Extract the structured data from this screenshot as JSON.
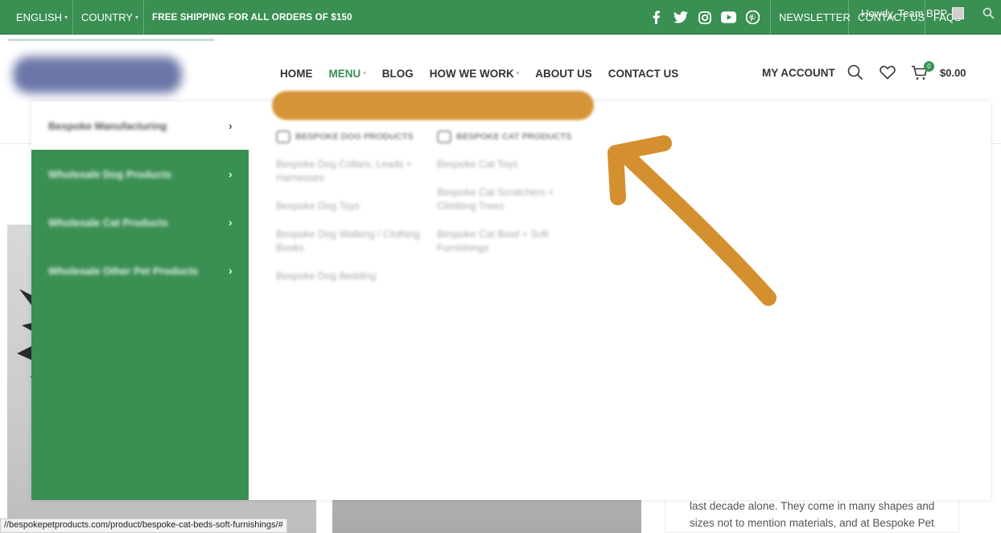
{
  "topbar": {
    "language": "ENGLISH",
    "country": "COUNTRY",
    "shipping": "FREE SHIPPING FOR ALL ORDERS OF $150",
    "newsletter": "NEWSLETTER",
    "contact": "CONTACT US",
    "faqs": "FAQS",
    "howdy": "Howdy, Team BPP",
    "social": [
      "facebook-icon",
      "twitter-icon",
      "instagram-icon",
      "youtube-icon",
      "pinterest-icon"
    ]
  },
  "header": {
    "nav": [
      "HOME",
      "MENU",
      "BLOG",
      "HOW WE WORK",
      "ABOUT US",
      "CONTACT US"
    ],
    "account": "MY ACCOUNT",
    "cart_count": "0",
    "cart_total": "$0.00"
  },
  "menu": {
    "categories": [
      "Bespoke Manufacturing",
      "Wholesale Dog Products",
      "Wholesale Cat Products",
      "Wholesale Other Pet Products"
    ],
    "columns": [
      {
        "title": "BESPOKE DOG PRODUCTS",
        "items": [
          "Bespoke Dog Collars, Leads + Harnesses",
          "Bespoke Dog Toys",
          "Bespoke Dog Walking / Clothing Books",
          "Bespoke Dog Bedding"
        ]
      },
      {
        "title": "BESPOKE CAT PRODUCTS",
        "items": [
          "Bespoke Cat Toys",
          "Bespoke Cat Scratchers + Climbing Trees",
          "Bespoke Cat Bowl + Soft Furnishings"
        ]
      }
    ]
  },
  "body": {
    "side_text": "last decade alone. They come in many shapes and sizes not to mention materials, and at Bespoke Pet"
  },
  "status_url": "//bespokepetproducts.com/product/bespoke-cat-beds-soft-furnishings/#",
  "colors": {
    "brand_green": "#3a8f53",
    "annotation": "#d48f2e"
  }
}
